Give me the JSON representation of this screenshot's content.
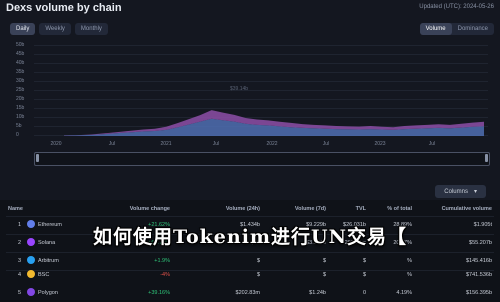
{
  "header": {
    "title": "Dexs volume by chain",
    "updated": "Updated (UTC): 2024-05-26"
  },
  "period_tabs": [
    {
      "label": "Daily",
      "active": true
    },
    {
      "label": "Weekly",
      "active": false
    },
    {
      "label": "Monthly",
      "active": false
    }
  ],
  "metric_toggle": [
    {
      "label": "Volume",
      "active": true
    },
    {
      "label": "Dominance",
      "active": false
    }
  ],
  "chart_data": {
    "type": "area",
    "title": "",
    "x_ticks": [
      "2020",
      "Jul",
      "2021",
      "Jul",
      "2022",
      "Jul",
      "2023",
      "Jul"
    ],
    "y_ticks": [
      "50b",
      "45b",
      "40b",
      "35b",
      "30b",
      "25b",
      "20b",
      "15b",
      "10b",
      "5b",
      "0"
    ],
    "ylim": [
      0,
      50
    ],
    "grid": true,
    "series": [
      {
        "color": "#4f6fb3",
        "values": [
          0.2,
          0.3,
          0.5,
          0.8,
          1.2,
          1.6,
          2.0,
          2.4,
          2.6,
          3.2,
          4.5,
          6.0,
          7.5,
          9.0,
          8.2,
          7.5,
          6.4,
          5.8,
          5.5,
          5.0,
          4.6,
          4.2,
          4.0,
          3.8,
          3.6,
          3.5,
          3.4,
          3.6,
          3.4,
          3.2,
          3.6,
          3.8,
          4.0,
          4.2,
          4.0,
          4.4,
          4.8,
          5.0
        ]
      },
      {
        "color": "#8d4fa8",
        "values": [
          0.1,
          0.1,
          0.2,
          0.3,
          0.4,
          0.6,
          0.8,
          1.0,
          1.2,
          1.6,
          2.2,
          2.8,
          3.4,
          4.5,
          4.0,
          3.5,
          3.0,
          2.8,
          2.6,
          2.4,
          2.2,
          2.0,
          1.8,
          1.7,
          1.6,
          1.5,
          1.5,
          1.6,
          1.4,
          1.4,
          1.6,
          1.7,
          1.8,
          1.9,
          1.8,
          2.0,
          2.2,
          2.4
        ]
      }
    ],
    "annotation": "$39.14b"
  },
  "columns_button": {
    "label": "Columns"
  },
  "table": {
    "headers": [
      "Name",
      "Volume change",
      "Volume (24h)",
      "Volume (7d)",
      "TVL",
      "% of total",
      "Cumulative volume"
    ],
    "rows": [
      {
        "rank": "1",
        "name": "Ethereum",
        "icon_color": "#627eea",
        "change": "+21.62%",
        "v24": "$1.434b",
        "v7d": "$9.229b",
        "tvl": "$26.031b",
        "pct": "28.89%",
        "cum": "$1.905t"
      },
      {
        "rank": "2",
        "name": "Solana",
        "icon_color": "#9945ff",
        "change": "+65.72%",
        "v24": "$1b",
        "v7d": "$3.351b",
        "tvl": "298.65m",
        "pct": "20.17%",
        "cum": "$55.207b"
      },
      {
        "rank": "3",
        "name": "Arbitrum",
        "icon_color": "#28a0f0",
        "change": "+1.9%",
        "v24": "$",
        "v7d": "$",
        "tvl": "$",
        "pct": "%",
        "cum": "$145.416b"
      },
      {
        "rank": "4",
        "name": "BSC",
        "icon_color": "#f3ba2f",
        "change": "-4%",
        "v24": "$",
        "v7d": "$",
        "tvl": "$",
        "pct": "%",
        "cum": "$741.536b"
      },
      {
        "rank": "5",
        "name": "Polygon",
        "icon_color": "#8247e5",
        "change": "+39.16%",
        "v24": "$202.83m",
        "v7d": "$1.24b",
        "tvl": "0",
        "pct": "4.19%",
        "cum": "$156.395b"
      }
    ]
  },
  "overlay": {
    "text": "如何使用Tokenim进行UN交易【"
  }
}
